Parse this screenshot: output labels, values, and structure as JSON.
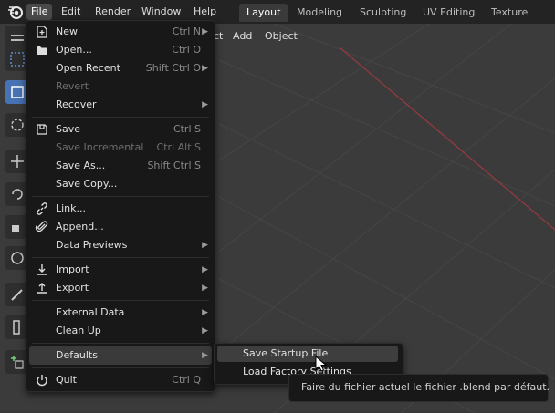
{
  "topbar": {
    "menus": [
      "File",
      "Edit",
      "Render",
      "Window",
      "Help"
    ],
    "workspaces": [
      "Layout",
      "Modeling",
      "Sculpting",
      "UV Editing",
      "Texture Paint"
    ]
  },
  "viewport": {
    "header": [
      "ct",
      "Add",
      "Object"
    ]
  },
  "file_menu": {
    "items": [
      {
        "label": "New",
        "shortcut": "Ctrl N",
        "icon": "new-file-icon",
        "submenu": true,
        "disabled": false
      },
      {
        "label": "Open...",
        "shortcut": "Ctrl O",
        "icon": "folder-icon",
        "submenu": false,
        "disabled": false
      },
      {
        "label": "Open Recent",
        "shortcut": "Shift Ctrl O",
        "icon": "",
        "submenu": true,
        "disabled": false
      },
      {
        "label": "Revert",
        "shortcut": "",
        "icon": "",
        "submenu": false,
        "disabled": true
      },
      {
        "label": "Recover",
        "shortcut": "",
        "icon": "",
        "submenu": true,
        "disabled": false
      },
      {
        "label": "Save",
        "shortcut": "Ctrl S",
        "icon": "save-icon",
        "submenu": false,
        "disabled": false
      },
      {
        "label": "Save Incremental",
        "shortcut": "Ctrl Alt S",
        "icon": "",
        "submenu": false,
        "disabled": true
      },
      {
        "label": "Save As...",
        "shortcut": "Shift Ctrl S",
        "icon": "",
        "submenu": false,
        "disabled": false
      },
      {
        "label": "Save Copy...",
        "shortcut": "",
        "icon": "",
        "submenu": false,
        "disabled": false
      },
      {
        "label": "Link...",
        "shortcut": "",
        "icon": "link-icon",
        "submenu": false,
        "disabled": false
      },
      {
        "label": "Append...",
        "shortcut": "",
        "icon": "append-icon",
        "submenu": false,
        "disabled": false
      },
      {
        "label": "Data Previews",
        "shortcut": "",
        "icon": "",
        "submenu": true,
        "disabled": false
      },
      {
        "label": "Import",
        "shortcut": "",
        "icon": "import-icon",
        "submenu": true,
        "disabled": false
      },
      {
        "label": "Export",
        "shortcut": "",
        "icon": "export-icon",
        "submenu": true,
        "disabled": false
      },
      {
        "label": "External Data",
        "shortcut": "",
        "icon": "",
        "submenu": true,
        "disabled": false
      },
      {
        "label": "Clean Up",
        "shortcut": "",
        "icon": "",
        "submenu": true,
        "disabled": false
      },
      {
        "label": "Defaults",
        "shortcut": "",
        "icon": "",
        "submenu": true,
        "disabled": false
      },
      {
        "label": "Quit",
        "shortcut": "Ctrl Q",
        "icon": "power-icon",
        "submenu": false,
        "disabled": false
      }
    ]
  },
  "defaults_submenu": {
    "items": [
      "Save Startup File",
      "Load Factory Settings"
    ]
  },
  "tooltip": {
    "text": "Faire du fichier actuel le fichier .blend par défaut."
  },
  "colors": {
    "topbar": "#232323",
    "viewport": "#3b3b3b",
    "menu_bg": "#181818",
    "highlight": "#3a3a3a",
    "tool_active": "#4772b3",
    "axis_x": "#9b3a3f"
  }
}
